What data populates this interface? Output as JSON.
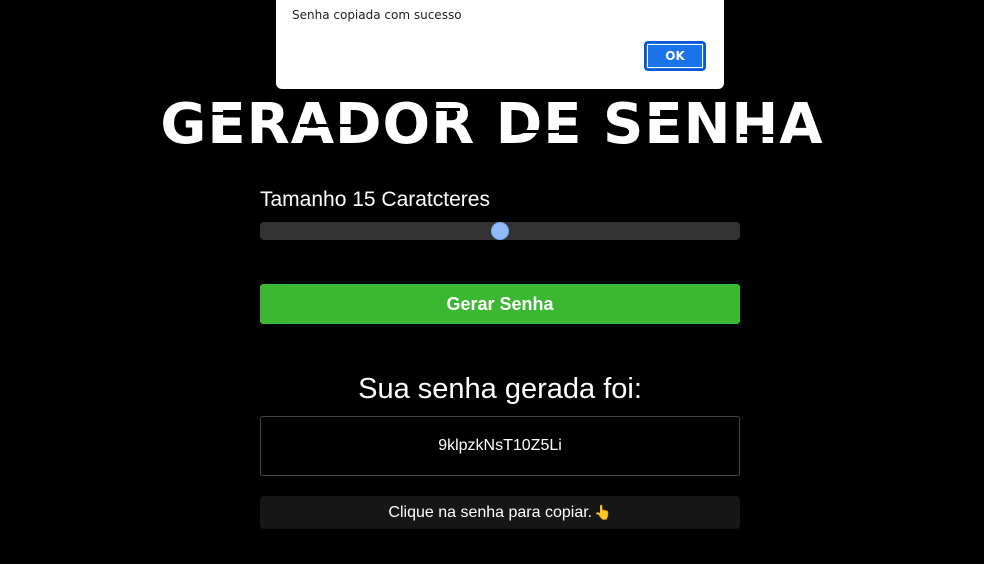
{
  "alert": {
    "message": "Senha copiada com sucesso",
    "ok_label": "OK"
  },
  "app": {
    "title": "GERADOR DE SENHA"
  },
  "length": {
    "label": "Tamanho 15 Caratcteres",
    "value": 15,
    "slider_fraction": 0.5
  },
  "generate_button": {
    "label": "Gerar Senha"
  },
  "result": {
    "heading": "Sua senha gerada foi:",
    "password": "9klpzkNsT10Z5Li"
  },
  "hint": {
    "text": "Clique na senha para copiar.",
    "icon": "pointing-hand-icon"
  },
  "colors": {
    "background": "#000000",
    "button_green": "#3cb731",
    "slider_thumb": "#8fbcf9",
    "alert_button": "#1a73e8"
  }
}
